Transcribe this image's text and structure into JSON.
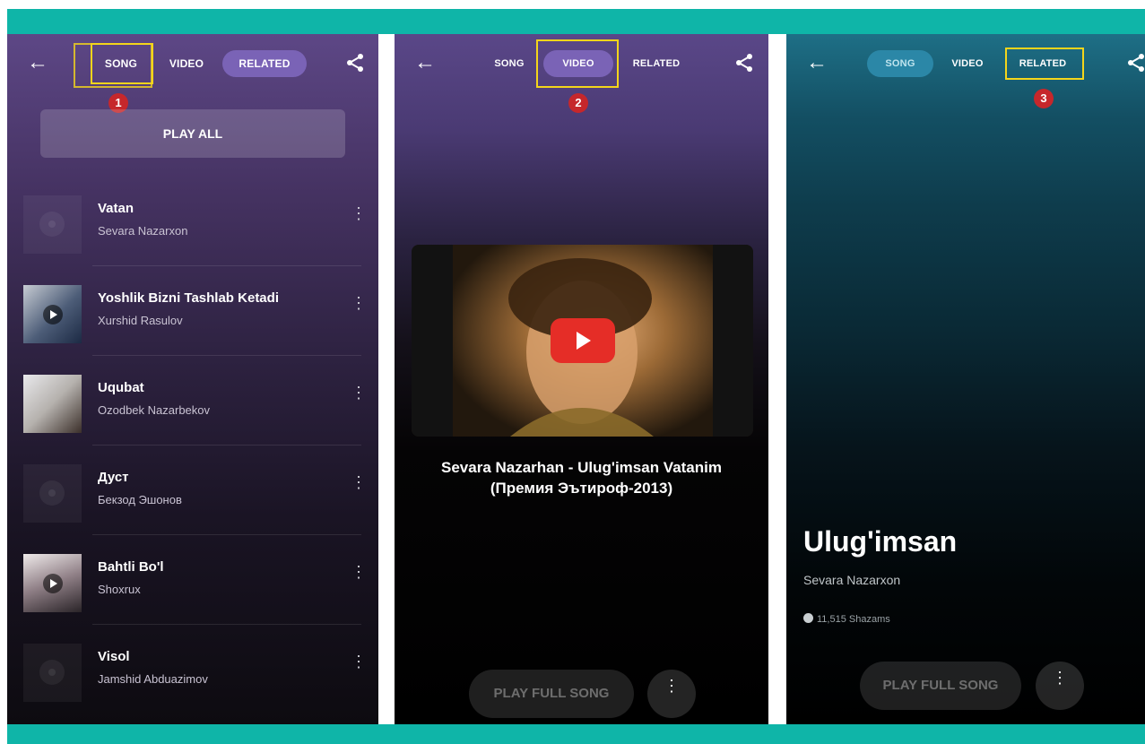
{
  "colors": {
    "frame_band": "#0fb5a8",
    "highlight": "#f4d51b",
    "badge": "#c6272b",
    "pill_purple": "#7a63b6",
    "pill_teal": "#2b87a7"
  },
  "panel1": {
    "tabs": [
      "SONG",
      "VIDEO",
      "RELATED"
    ],
    "active_tab": "RELATED",
    "highlighted_tab": "SONG",
    "badge": "1",
    "play_all_label": "PLAY ALL",
    "songs": [
      {
        "title": "Vatan",
        "artist": "Sevara Nazarxon",
        "artwork": "placeholder"
      },
      {
        "title": "Yoshlik Bizni Tashlab Ketadi",
        "artist": "Xurshid Rasulov",
        "artwork": "photo-with-play"
      },
      {
        "title": "Uqubat",
        "artist": "Ozodbek Nazarbekov",
        "artwork": "photo"
      },
      {
        "title": "Дуст",
        "artist": "Бекзод Эшонов",
        "artwork": "placeholder"
      },
      {
        "title": "Bahtli Bo'l",
        "artist": "Shoxrux",
        "artwork": "photo-with-play"
      },
      {
        "title": "Visol",
        "artist": "Jamshid Abduazimov",
        "artwork": "placeholder"
      }
    ]
  },
  "panel2": {
    "tabs": [
      "SONG",
      "VIDEO",
      "RELATED"
    ],
    "active_tab": "VIDEO",
    "highlighted_tab": "VIDEO",
    "badge": "2",
    "video_title_line1": "Sevara Nazarhan - Ulug'imsan Vatanim",
    "video_title_line2": "(Премия Эътироф-2013)",
    "play_full_song_label": "PLAY FULL SONG",
    "more_icon": "vertical-dots-icon"
  },
  "panel3": {
    "tabs": [
      "SONG",
      "VIDEO",
      "RELATED"
    ],
    "active_tab": "SONG",
    "highlighted_tab": "RELATED",
    "badge": "3",
    "song_title": "Ulug'imsan",
    "artist": "Sevara Nazarxon",
    "shazam_count": "11,515 Shazams",
    "play_full_song_label": "PLAY FULL SONG",
    "more_icon": "vertical-dots-icon"
  }
}
